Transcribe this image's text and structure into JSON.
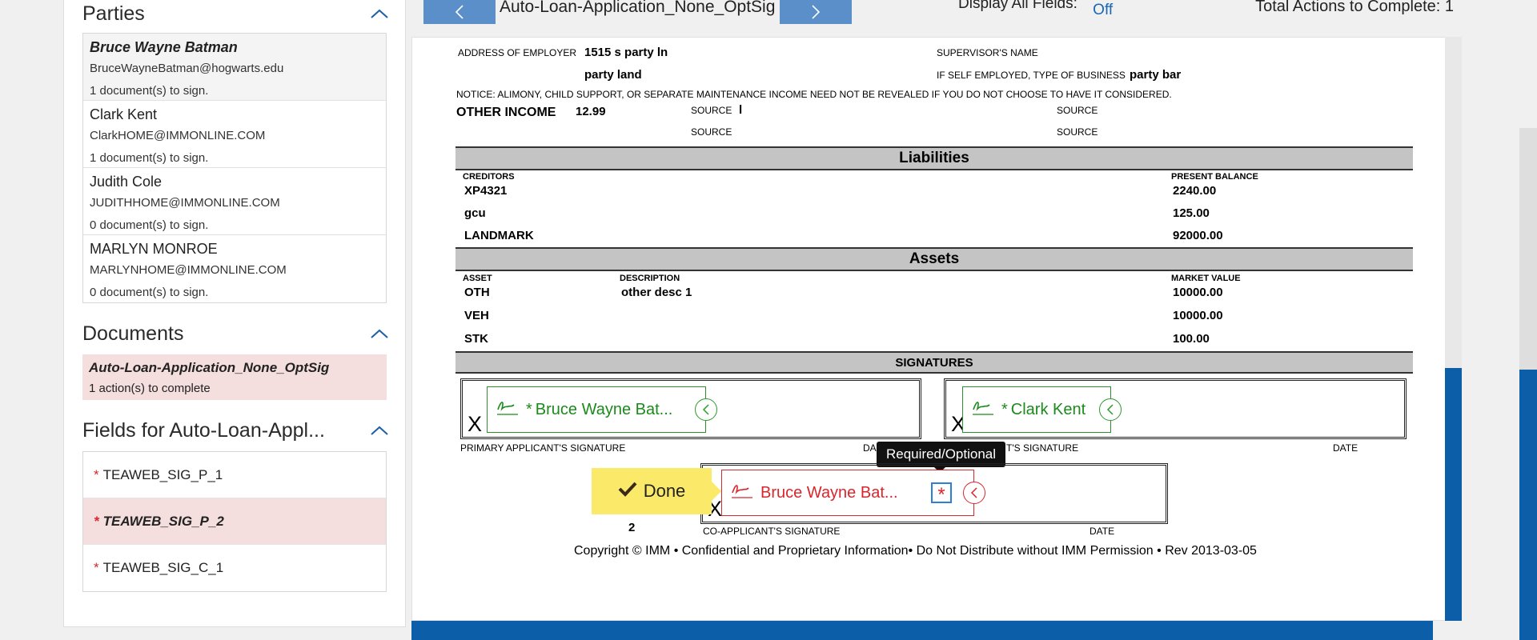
{
  "parties": {
    "title": "Parties",
    "items": [
      {
        "name": "Bruce Wayne Batman",
        "email": "BruceWayneBatman@hogwarts.edu",
        "count": "1 document(s) to sign."
      },
      {
        "name": "Clark Kent",
        "email": "ClarkHOME@IMMONLINE.COM",
        "count": "1 document(s) to sign."
      },
      {
        "name": "Judith Cole",
        "email": "JUDITHHOME@IMMONLINE.COM",
        "count": "0 document(s) to sign."
      },
      {
        "name": "MARLYN MONROE",
        "email": "MARLYNHOME@IMMONLINE.COM",
        "count": "0 document(s) to sign."
      }
    ]
  },
  "documents": {
    "title": "Documents",
    "items": [
      {
        "name": "Auto-Loan-Application_None_OptSig",
        "count": "1 action(s) to complete"
      }
    ]
  },
  "fields": {
    "title": "Fields for Auto-Loan-Appl...",
    "items": [
      {
        "star": "*",
        "label": "TEAWEB_SIG_P_1"
      },
      {
        "star": "*",
        "label": "TEAWEB_SIG_P_2"
      },
      {
        "star": "*",
        "label": "TEAWEB_SIG_C_1"
      }
    ]
  },
  "toolbar": {
    "prev_icon": "chevron-left-icon",
    "next_icon": "chevron-right-icon",
    "doc_title": "Auto-Loan-Application_None_OptSig",
    "display_all_label": "Display All Fields:",
    "display_all_value": "Off",
    "total_actions": "Total Actions to Complete: 1"
  },
  "form": {
    "employer_address_label": "ADDRESS OF EMPLOYER",
    "employer_address_line1": "1515 s party ln",
    "employer_address_line2": "party land",
    "supervisor_label": "SUPERVISOR'S NAME",
    "self_employed_label": "IF SELF EMPLOYED, TYPE OF BUSINESS",
    "self_employed_value": "party bar",
    "notice": "NOTICE: ALIMONY, CHILD SUPPORT, OR SEPARATE MAINTENANCE INCOME NEED NOT BE REVEALED IF YOU DO NOT CHOOSE TO HAVE IT CONSIDERED.",
    "other_income_label": "OTHER INCOME",
    "other_income_value": "12.99",
    "source_label": "SOURCE",
    "source_value_1": "l",
    "liabilities_title": "Liabilities",
    "creditors_label": "CREDITORS",
    "present_balance_label": "PRESENT BALANCE",
    "creditors": [
      {
        "name": "XP4321",
        "balance": "2240.00"
      },
      {
        "name": "gcu",
        "balance": "125.00"
      },
      {
        "name": "LANDMARK",
        "balance": "92000.00"
      }
    ],
    "assets_title": "Assets",
    "asset_label": "ASSET",
    "description_label": "DESCRIPTION",
    "market_value_label": "MARKET VALUE",
    "assets": [
      {
        "asset": "OTH",
        "description": "other desc 1",
        "value": "10000.00"
      },
      {
        "asset": "VEH",
        "description": "",
        "value": "10000.00"
      },
      {
        "asset": "STK",
        "description": "",
        "value": "100.00"
      }
    ],
    "signatures_title": "SIGNATURES",
    "sig_x": "X",
    "primary_sig_label": "PRIMARY APPLICANT'S SIGNATURE",
    "date_label_partial": "DA",
    "co_sig_label_partial": "T'S SIGNATURE",
    "date_label": "DATE",
    "co_applicant_sig_label": "CO-APPLICANT'S SIGNATURE",
    "sig_chip_1": "Bruce Wayne Bat...",
    "sig_chip_2": "Clark Kent",
    "sig_chip_3": "Bruce Wayne Bat...",
    "chip_star": "*",
    "tooltip": "Required/Optional",
    "required_star": "*",
    "done_label": "Done",
    "done_count": "2",
    "copyright": "Copyright © IMM • Confidential and Proprietary Information• Do Not Distribute without IMM Permission • Rev 2013-03-05"
  },
  "colors": {
    "accent_blue": "#0d5ea8",
    "nav_blue": "#5b8fc9",
    "signed_green": "#1b8a1b",
    "required_red": "#d8262c",
    "done_yellow": "#fbe96a",
    "active_pink": "#f5dede"
  }
}
